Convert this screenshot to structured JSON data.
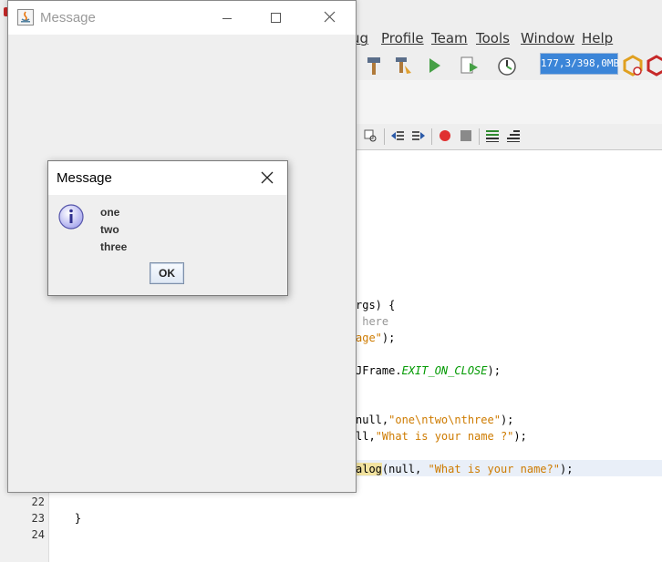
{
  "ide": {
    "menu": [
      "ug",
      "Profile",
      "Team",
      "Tools",
      "Window",
      "Help"
    ],
    "memory_label": "177,3/398,0MB",
    "line_numbers": [
      "22",
      "23",
      "24"
    ],
    "code": {
      "l1": "rgs) {",
      "l2": " here",
      "l3_str": "age\"",
      "l3_end": ");",
      "l4_pre": "JFrame.",
      "l4_const": "EXIT_ON_CLOSE",
      "l4_end": ");",
      "l5_pre": "null,",
      "l5_str": "\"one\\ntwo\\nthree\"",
      "l5_end": ");",
      "l6_pre": "ll,",
      "l6_str": "\"What is your name ?\"",
      "l6_end": ");",
      "l7_hl": "alog",
      "l7_pre": "(null, ",
      "l7_str": "\"What is your name?\"",
      "l7_end": ");",
      "l23": "    }"
    }
  },
  "frame": {
    "title": "Message"
  },
  "dialog": {
    "title": "Message",
    "lines": [
      "one",
      "two",
      "three"
    ],
    "ok_label": "OK"
  }
}
